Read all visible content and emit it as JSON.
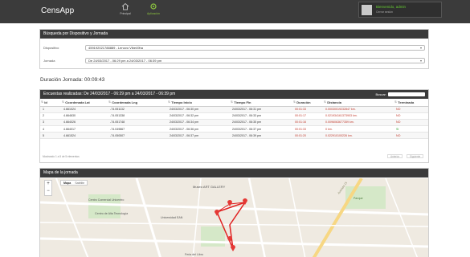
{
  "app": {
    "brand": "CensApp"
  },
  "nav": [
    {
      "label": "Principal",
      "icon": "home-icon"
    },
    {
      "label": "Aplicación",
      "icon": "gear-icon"
    }
  ],
  "user": {
    "greeting": "Bienvenido, admin",
    "subtitle": "Cerrar sesión"
  },
  "filter_panel": {
    "title": "Búsqueda por Dispositivo y Jornada",
    "device_label": "Dispositivo",
    "device_value": "459192021788889 - Lenovo Vibe49ha",
    "session_label": "Jornada",
    "session_value": "De 24/03/2017 - 06:29 pm a 24/03/2017 - 06:39 pm"
  },
  "duration": "Duración Jornada: 00:09:43",
  "surveys_panel": {
    "title": "Encuestas realizadas: De 24/03/2017 - 06:29 pm a 24/03/2017 - 06:39 pm",
    "search_label": "Buscar:",
    "columns": [
      "Id",
      "Coordenada Lat",
      "Coordenada Lng",
      "Tiempo Inicio",
      "Tiempo Fin",
      "Duración",
      "Distancia",
      "Terminada"
    ],
    "rows": [
      [
        "1",
        "4.661024",
        "-74.051132",
        "24/03/2017 - 06:30 pm",
        "24/03/2017 - 06:31 pm",
        "00:01:33",
        "0.00030019232847 km.",
        "NO"
      ],
      [
        "2",
        "4.664630",
        "-74.051338",
        "24/03/2017 - 06:32 pm",
        "24/03/2017 - 06:33 pm",
        "00:01:17",
        "0.021934161373903 km.",
        "NO"
      ],
      [
        "3",
        "4.664026",
        "-74.051748",
        "24/03/2017 - 06:34 pm",
        "24/03/2017 - 06:35 pm",
        "00:01:16",
        "0.0096063677359 km.",
        "NO"
      ],
      [
        "4",
        "4.664017",
        "-74.049867",
        "24/03/2017 - 06:36 pm",
        "24/03/2017 - 06:37 pm",
        "00:01:33",
        "0 km.",
        "SI"
      ],
      [
        "5",
        "4.661524",
        "-74.050507",
        "24/03/2017 - 06:37 pm",
        "24/03/2017 - 06:39 pm",
        "00:01:20",
        "0.022910100226 km.",
        "NO"
      ]
    ],
    "footer": "Mostrando 1 a 5 de 5 elementos",
    "prev_label": "Anterior",
    "next_label": "Siguiente"
  },
  "map_panel": {
    "title": "Mapa de la jornada",
    "map_btn": "Mapa",
    "sat_btn": "Satélite",
    "zoom_in": "+",
    "zoom_out": "−",
    "labels": [
      "Museo ART GALLERY",
      "Centro Comercial Unicentro",
      "Centro de Alta Tecnología",
      "Universidad EAN",
      "Feria del Libro",
      "Parque",
      "Avenida 15"
    ]
  }
}
